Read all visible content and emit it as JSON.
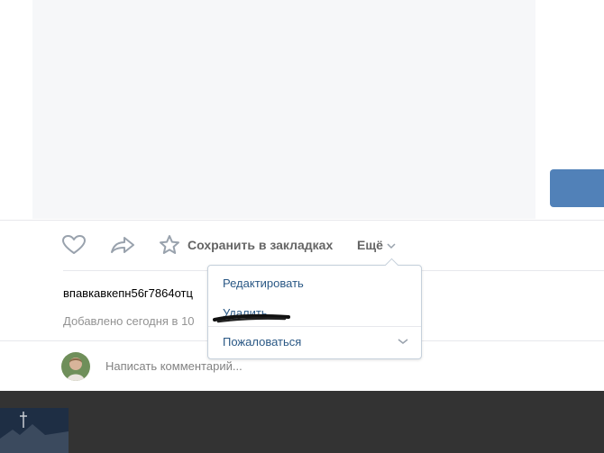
{
  "post": {
    "actions": {
      "like_icon": "heart-icon",
      "share_icon": "share-arrow-icon",
      "bookmark_icon": "star-icon",
      "bookmark_label": "Сохранить в закладках",
      "more_label": "Ещё"
    },
    "text": "впавкавкепн56г7864отц",
    "date": "Добавлено сегодня в 10"
  },
  "dropdown": {
    "items": [
      {
        "label": "Редактировать"
      },
      {
        "label": "Удалить"
      },
      {
        "label": "Пожаловаться"
      }
    ]
  },
  "comment": {
    "placeholder": "Написать комментарий..."
  },
  "colors": {
    "link": "#2a5885",
    "accent_button": "#5181b8",
    "footer": "#333333"
  }
}
